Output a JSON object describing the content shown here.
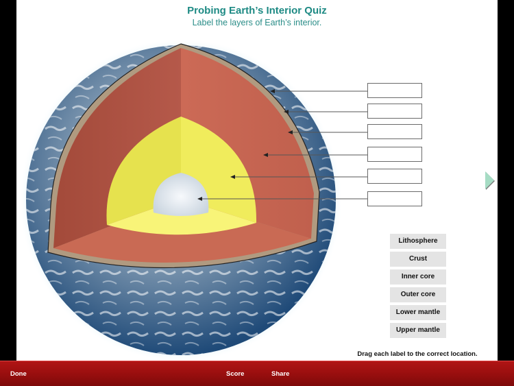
{
  "header": {
    "title": "Probing Earth’s Interior Quiz",
    "subtitle": "Label the layers of Earth’s interior."
  },
  "diagram": {
    "subject": "cutaway of Earth showing interior layers",
    "layer_colors": {
      "crust_surface": "#2f5b86",
      "mantle": "#c0614d",
      "outer_core": "#f0ec5a",
      "inner_core": "#e9eef3"
    },
    "drop_targets": [
      "",
      "",
      "",
      "",
      "",
      ""
    ]
  },
  "labels": [
    {
      "text": "Lithosphere"
    },
    {
      "text": "Crust"
    },
    {
      "text": "Inner core"
    },
    {
      "text": "Outer core"
    },
    {
      "text": "Lower mantle"
    },
    {
      "text": "Upper mantle"
    }
  ],
  "instruction": "Drag each label to the correct location.",
  "navigation": {
    "next_icon": "next-page-arrow-icon",
    "next_color": "#a6dcc4"
  },
  "toolbar": {
    "done_label": "Done",
    "score_label": "Score",
    "share_label": "Share",
    "color": "#9c0f0f"
  }
}
